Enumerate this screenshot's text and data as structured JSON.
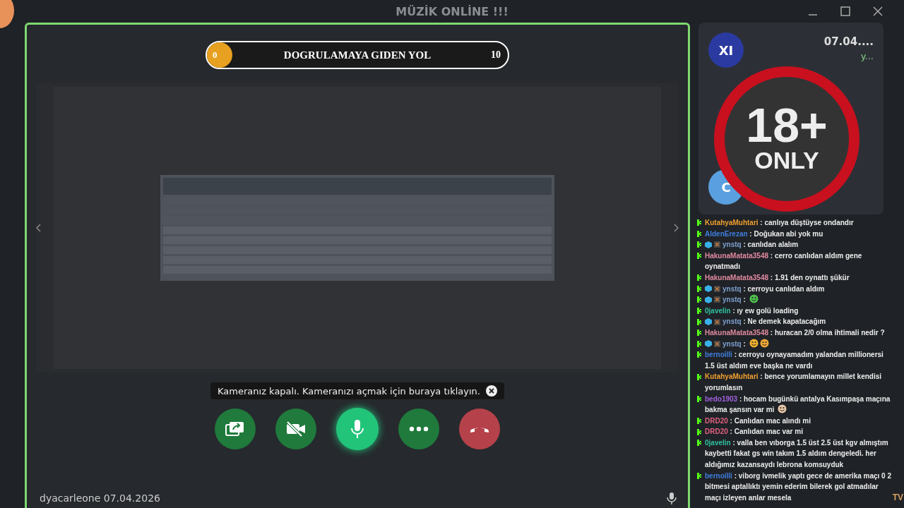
{
  "window": {
    "title": "MÜZİK ONLİNE !!!"
  },
  "progress": {
    "start": "0",
    "title": "DOGRULAMAYA GIDEN YOL",
    "end": "10",
    "level": 0
  },
  "camera_tip": {
    "text": "Kameranız kapalı. Kameranızı açmak için buraya tıklayın."
  },
  "controls": [
    {
      "kind": "share",
      "active": false
    },
    {
      "kind": "camera",
      "active": false
    },
    {
      "kind": "mic",
      "active": true
    },
    {
      "kind": "more",
      "active": false
    },
    {
      "kind": "hangup",
      "active": false
    }
  ],
  "speaker": {
    "name": "dyacarleone 07.04.2026"
  },
  "participants": [
    {
      "avatar": "XI",
      "color": "#2a3aa0",
      "name": "07.04....",
      "status": "y..."
    },
    {
      "avatar": "C",
      "color": "#5aa0e0"
    }
  ],
  "overlay_badge": {
    "number": "18+",
    "text": "ONLY"
  },
  "chat": [
    {
      "user": "KutahyaMuhtari",
      "color": "#f0a030",
      "badges": [
        {
          "kind": "k"
        }
      ],
      "text": ": canlıya düştüyse ondandır"
    },
    {
      "user": "AldenErezan",
      "color": "#3f7fe0",
      "badges": [
        {
          "kind": "k"
        }
      ],
      "text": ": Doğukan abi yok mu"
    },
    {
      "user": "ynstq",
      "color": "#7fa0d0",
      "badges": [
        {
          "kind": "k"
        },
        {
          "kind": "cube"
        },
        {
          "kind": "x"
        }
      ],
      "text": ": canlıdan alalım"
    },
    {
      "user": "HakunaMatata3548",
      "color": "#e08aa0",
      "badges": [
        {
          "kind": "k"
        }
      ],
      "text": ": cerro canlıdan aldım gene oynatmadı"
    },
    {
      "user": "HakunaMatata3548",
      "color": "#e08aa0",
      "badges": [
        {
          "kind": "k"
        }
      ],
      "text": ": 1.91 den oynattı şükür"
    },
    {
      "user": "ynstq",
      "color": "#7fa0d0",
      "badges": [
        {
          "kind": "k"
        },
        {
          "kind": "cube"
        },
        {
          "kind": "x"
        }
      ],
      "text": ": cerroyu canlıdan aldım"
    },
    {
      "user": "ynstq",
      "color": "#7fa0d0",
      "badges": [
        {
          "kind": "k"
        },
        {
          "kind": "cube"
        },
        {
          "kind": "x"
        }
      ],
      "text": ":",
      "emotes": [
        {
          "color": "#4cc04c"
        }
      ]
    },
    {
      "user": "0javelin",
      "color": "#30c0a0",
      "badges": [
        {
          "kind": "k"
        }
      ],
      "text": ": ıy ew golü loading"
    },
    {
      "user": "ynstq",
      "color": "#7fa0d0",
      "badges": [
        {
          "kind": "k"
        },
        {
          "kind": "cube"
        },
        {
          "kind": "x"
        }
      ],
      "text": ": Ne demek kapatacağım"
    },
    {
      "user": "HakunaMatata3548",
      "color": "#e08aa0",
      "badges": [
        {
          "kind": "k"
        }
      ],
      "text": ": huracan 2/0 olma ihtimali nedir ?"
    },
    {
      "user": "ynstq",
      "color": "#7fa0d0",
      "badges": [
        {
          "kind": "k"
        },
        {
          "kind": "cube"
        },
        {
          "kind": "x"
        }
      ],
      "text": ":",
      "emotes": [
        {
          "color": "#f0b030"
        },
        {
          "color": "#f0a838"
        }
      ]
    },
    {
      "user": "bernoilli",
      "color": "#3f7fe0",
      "badges": [
        {
          "kind": "k"
        }
      ],
      "text": ": cerroyu oynayamadım yalandan millionersi 1.5 üst aldım eve başka ne vardı"
    },
    {
      "user": "KutahyaMuhtari",
      "color": "#f0a030",
      "badges": [
        {
          "kind": "k"
        }
      ],
      "text": ": bence yorumlamayın millet kendisi yorumlasın"
    },
    {
      "user": "bedo1903",
      "color": "#a060e0",
      "badges": [
        {
          "kind": "k"
        }
      ],
      "text": ": hocam bugünkü antalya Kasımpaşa maçına bakma şansın var mi",
      "emotes": [
        {
          "color": "#e8c8a8"
        }
      ]
    },
    {
      "user": "DRD20",
      "color": "#e06080",
      "badges": [
        {
          "kind": "k"
        }
      ],
      "text": ": Canlıdan mac alındı mi"
    },
    {
      "user": "DRD20",
      "color": "#e06080",
      "badges": [
        {
          "kind": "k"
        }
      ],
      "text": ": Canlıdan mac var mi"
    },
    {
      "user": "0javelin",
      "color": "#30c0a0",
      "badges": [
        {
          "kind": "k"
        }
      ],
      "text": ": valla ben vıborga 1.5 üst 2.5 üst kgv almıştım kaybetti fakat gs win takım 1.5 aldım dengeledi. her aldığımız kazansaydı lebrona komsuyduk"
    },
    {
      "user": "bernoilli",
      "color": "#3f7fe0",
      "badges": [
        {
          "kind": "k"
        }
      ],
      "text": ": viborg ivmelik yaptı gece de amerika maçı 0 2 bitmesi aptallıktı yemin ederim bilerek gol atmadılar maçı izleyen anlar mesela"
    }
  ],
  "corner_mark": "TV"
}
